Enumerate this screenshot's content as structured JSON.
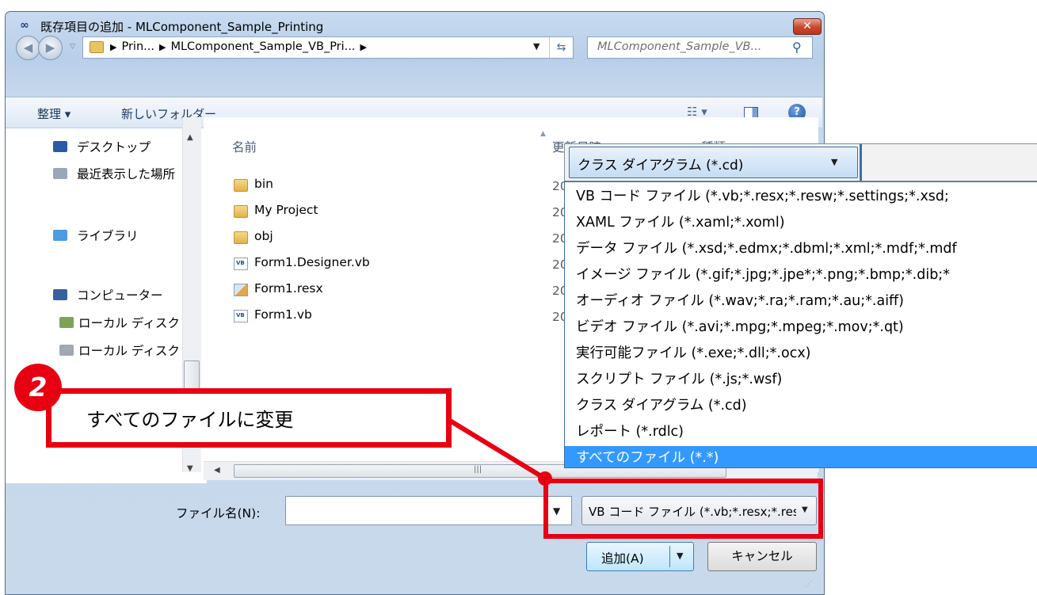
{
  "window": {
    "title": "既存項目の追加 - MLComponent_Sample_Printing",
    "close_icon": "close-icon",
    "close_glyph": "✕"
  },
  "address": {
    "crumbs": [
      "Prin...",
      "MLComponent_Sample_VB_Pri..."
    ],
    "search_placeholder": "MLComponent_Sample_VB... "
  },
  "toolbar": {
    "organize_label": "整理 ▾",
    "new_folder_label": "新しいフォルダー",
    "help_glyph": "?"
  },
  "nav": {
    "items": [
      {
        "label": "デスクトップ",
        "icon": "desktop-icon"
      },
      {
        "label": "最近表示した場所",
        "icon": "recent-places-icon"
      },
      {
        "label": "ライブラリ",
        "icon": "library-icon"
      },
      {
        "label": "コンピューター",
        "icon": "computer-icon"
      },
      {
        "label": "ローカル ディスク",
        "icon": "local-disk-icon"
      },
      {
        "label": "ローカル ディスク",
        "icon": "local-disk-icon"
      }
    ]
  },
  "filelist": {
    "columns": [
      "名前",
      "更新日時",
      "種類"
    ],
    "files": [
      {
        "name": "bin",
        "icon": "folder-icon",
        "date": "20"
      },
      {
        "name": "My Project",
        "icon": "folder-icon",
        "date": "20"
      },
      {
        "name": "obj",
        "icon": "folder-icon",
        "date": "20"
      },
      {
        "name": "Form1.Designer.vb",
        "icon": "vb-file-icon",
        "date": "20"
      },
      {
        "name": "Form1.resx",
        "icon": "resx-file-icon",
        "date": "20"
      },
      {
        "name": "Form1.vb",
        "icon": "vb-file-icon",
        "date": "20"
      }
    ]
  },
  "bottom": {
    "filename_label": "ファイル名(N):",
    "filename_value": "",
    "filetype_value": "VB コード ファイル (*.vb;*.resx;*.resw;*.settings;*.xsd;",
    "add_label": "追加(A)",
    "cancel_label": "キャンセル"
  },
  "dropdown": {
    "selected_label": "クラス ダイアグラム (*.cd)",
    "options": [
      "VB コード ファイル (*.vb;*.resx;*.resw;*.settings;*.xsd;",
      "XAML ファイル (*.xaml;*.xoml)",
      "データ ファイル (*.xsd;*.edmx;*.dbml;*.xml;*.mdf;*.mdf",
      "イメージ ファイル (*.gif;*.jpg;*.jpe*;*.png;*.bmp;*.dib;*",
      "オーディオ ファイル (*.wav;*.ra;*.ram;*.au;*.aiff)",
      "ビデオ ファイル (*.avi;*.mpg;*.mpeg;*.mov;*.qt)",
      "実行可能ファイル (*.exe;*.dll;*.ocx)",
      "スクリプト ファイル (*.js;*.wsf)",
      "クラス ダイアグラム (*.cd)",
      "レポート (*.rdlc)",
      "すべてのファイル (*.*)"
    ],
    "highlighted_index": 10
  },
  "annotation": {
    "step_number": "2",
    "text": "すべてのファイルに変更",
    "color": "#e60012"
  },
  "colors": {
    "selection": "#3399ff",
    "annotation_red": "#e60012"
  }
}
